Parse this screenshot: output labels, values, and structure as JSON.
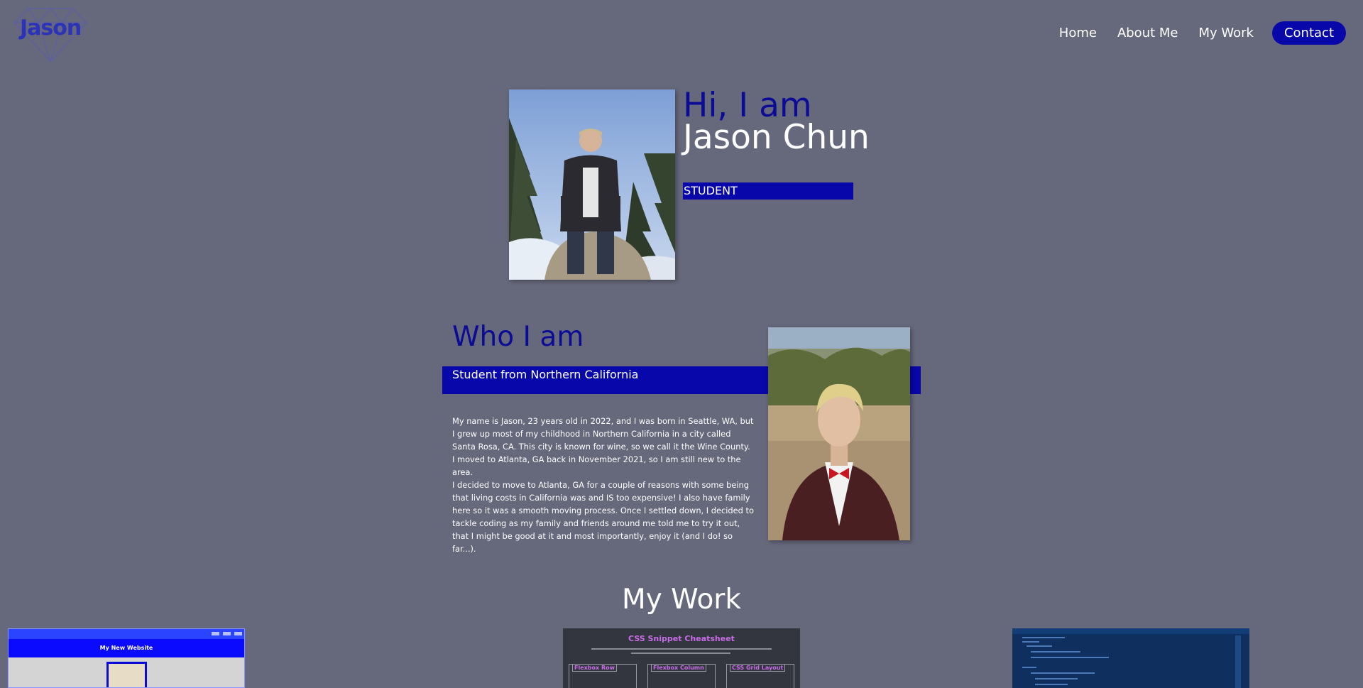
{
  "header": {
    "logo_text": "Jason",
    "nav": {
      "home": "Home",
      "about": "About Me",
      "work": "My Work",
      "contact": "Contact"
    }
  },
  "hero": {
    "greeting": "Hi, I am",
    "name": "Jason Chun",
    "role": "STUDENT"
  },
  "about": {
    "title": "Who I am",
    "subtitle": "Student from Northern California",
    "paragraphs": [
      "My name is Jason, 23 years old in 2022, and I was born in Seattle, WA, but I grew up most of my childhood in Northern California in a city called Santa Rosa, CA. This city is known for wine, so we call it the Wine County. I moved to Atlanta, GA back in November 2021, so I am still new to the area.",
      "I decided to move to Atlanta, GA for a couple of reasons with some being that living costs in California was and IS too expensive! I also have family here so it was a smooth moving process. Once I settled down, I decided to tackle coding as my family and friends around me told me to try it out, that I might be good at it and most importantly, enjoy it (and I do! so far...)."
    ]
  },
  "work": {
    "title": "My Work",
    "cards": [
      {
        "heading": "My New Website"
      },
      {
        "heading": "CSS Snippet Cheatsheet",
        "boxes": [
          "Flexbox Row",
          "Flexbox Column",
          "CSS Grid Layout"
        ]
      },
      {
        "heading": ""
      }
    ]
  },
  "colors": {
    "background": "#66687c",
    "accent_blue": "#0707aa",
    "heading_blue": "#0b0b96"
  }
}
